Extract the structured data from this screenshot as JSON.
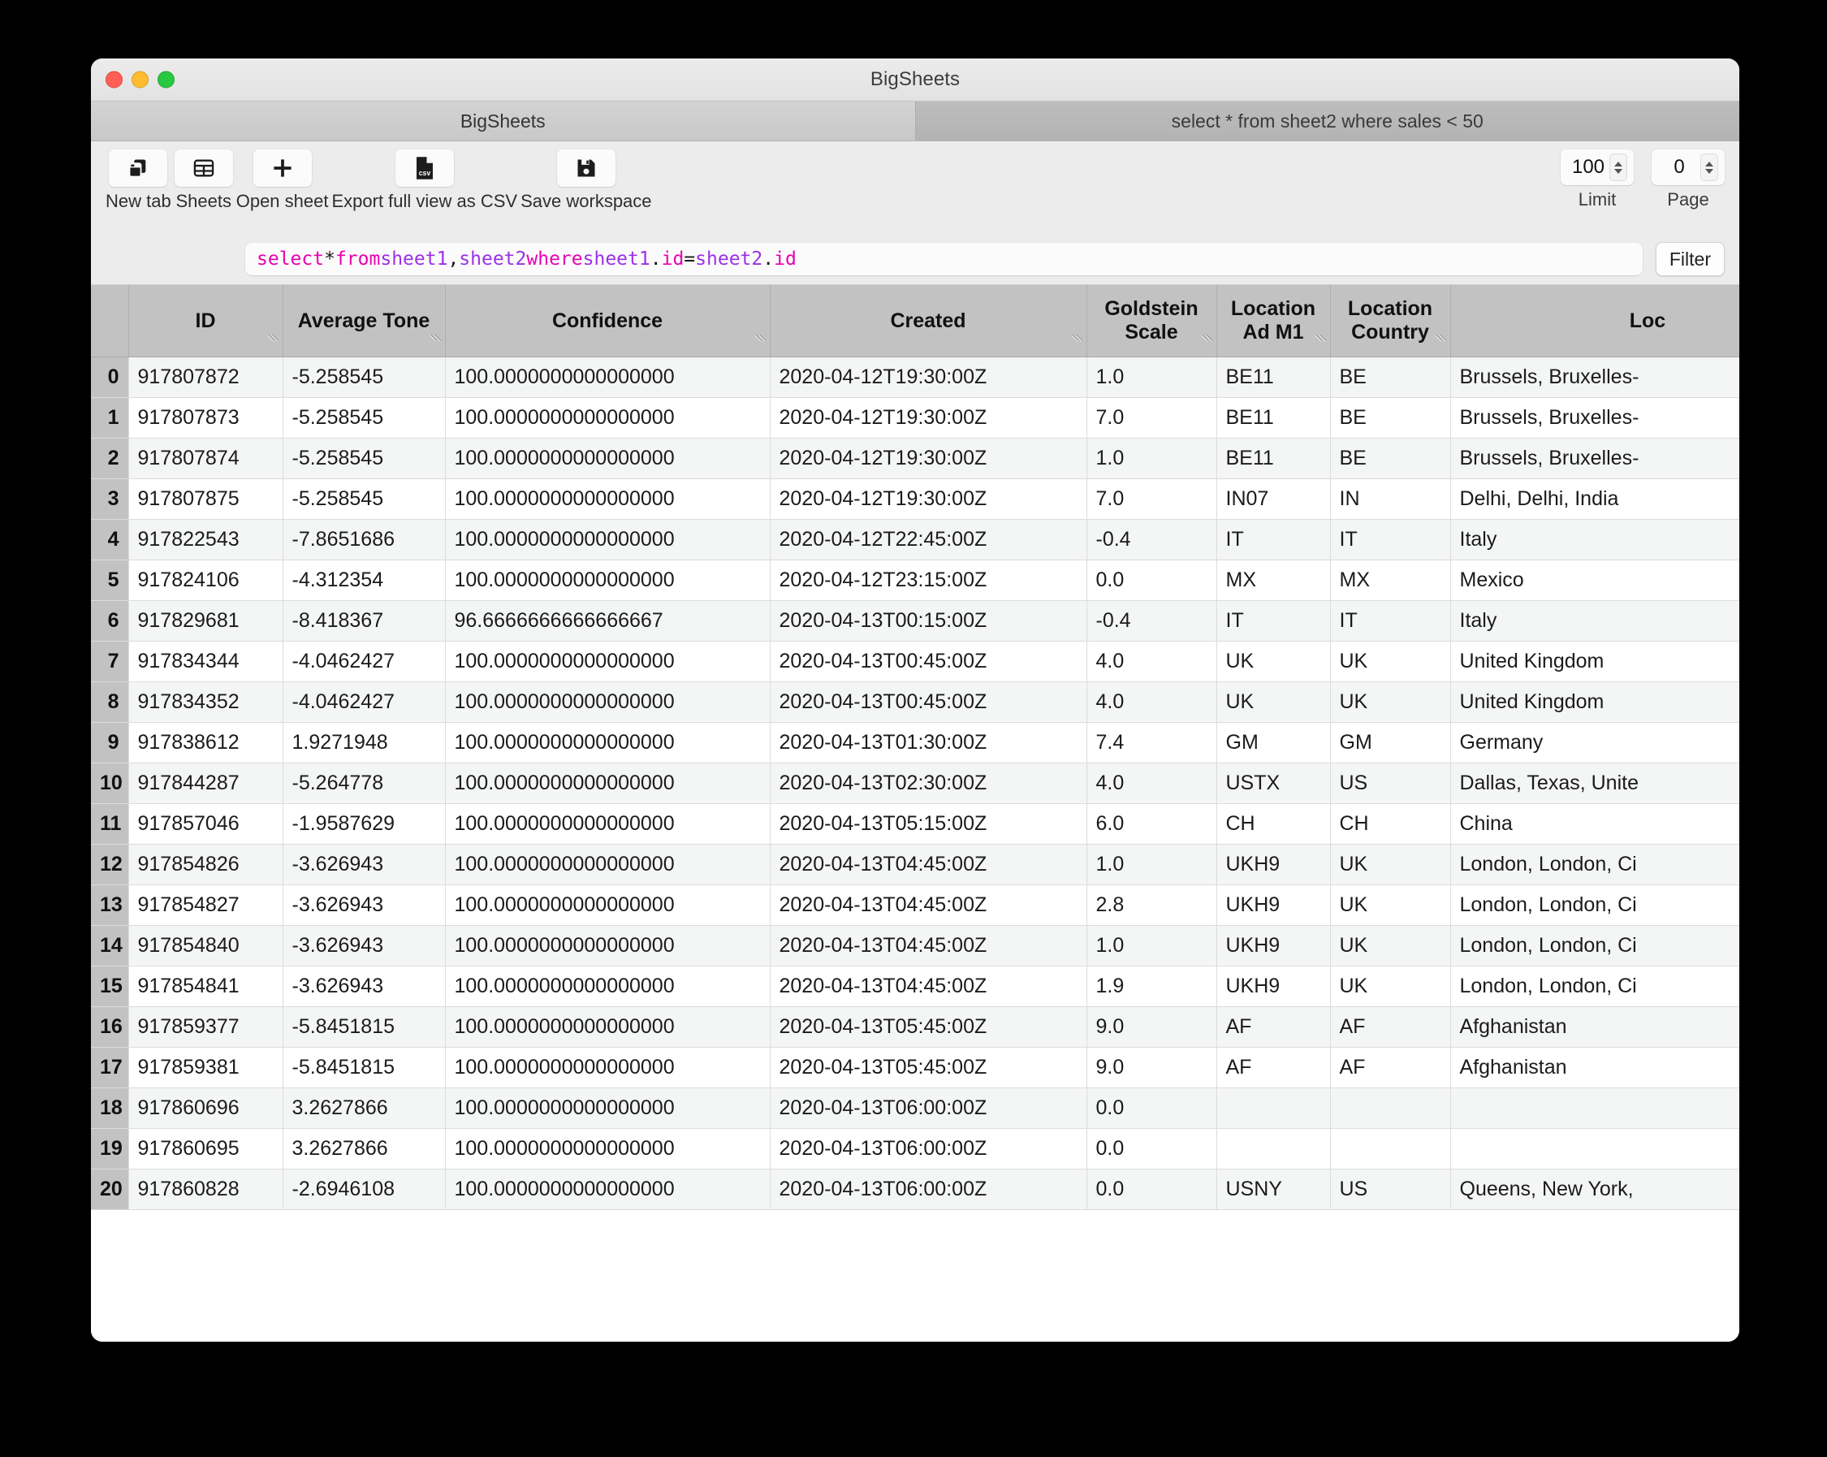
{
  "window": {
    "title": "BigSheets",
    "traffic_lights": [
      "close",
      "minimize",
      "maximize"
    ]
  },
  "tabs": [
    {
      "label": "BigSheets",
      "active": true
    },
    {
      "label": "select * from sheet2 where sales < 50",
      "active": false
    }
  ],
  "toolbar": {
    "buttons": [
      {
        "label": "New tab",
        "icon": "new-tab-icon"
      },
      {
        "label": "Sheets",
        "icon": "sheets-grid-icon"
      },
      {
        "label": "Open sheet",
        "icon": "plus-icon"
      },
      {
        "label": "Export full view as CSV",
        "icon": "csv-file-icon"
      },
      {
        "label": "Save workspace",
        "icon": "floppy-disk-icon"
      }
    ],
    "limit": {
      "label": "Limit",
      "value": "100"
    },
    "page": {
      "label": "Page",
      "value": "0"
    }
  },
  "query": {
    "text": "select * from sheet1, sheet2 where sheet1.id = sheet2.id",
    "tokens": [
      {
        "t": "select",
        "k": "kw"
      },
      {
        "t": " ",
        "k": "plain"
      },
      {
        "t": "*",
        "k": "plain"
      },
      {
        "t": " ",
        "k": "plain"
      },
      {
        "t": "from",
        "k": "kw"
      },
      {
        "t": " ",
        "k": "plain"
      },
      {
        "t": "sheet1",
        "k": "ident"
      },
      {
        "t": ", ",
        "k": "plain"
      },
      {
        "t": "sheet2",
        "k": "ident"
      },
      {
        "t": " ",
        "k": "plain"
      },
      {
        "t": "where",
        "k": "kw"
      },
      {
        "t": " ",
        "k": "plain"
      },
      {
        "t": "sheet1",
        "k": "ident"
      },
      {
        "t": ".",
        "k": "plain"
      },
      {
        "t": "id",
        "k": "kw"
      },
      {
        "t": " = ",
        "k": "plain"
      },
      {
        "t": "sheet2",
        "k": "ident"
      },
      {
        "t": ".",
        "k": "plain"
      },
      {
        "t": "id",
        "k": "kw"
      }
    ],
    "filter_label": "Filter"
  },
  "table": {
    "columns": [
      "ID",
      "Average Tone",
      "Confidence",
      "Created",
      "Goldstein Scale",
      "Location Ad M1",
      "Location Country",
      "Loc"
    ],
    "rows": [
      {
        "n": "0",
        "id": "917807872",
        "tone": "-5.258545",
        "conf": "100.0000000000000000",
        "created": "2020-04-12T19:30:00Z",
        "gold": "1.0",
        "adm1": "BE11",
        "ctry": "BE",
        "loc": "Brussels, Bruxelles-"
      },
      {
        "n": "1",
        "id": "917807873",
        "tone": "-5.258545",
        "conf": "100.0000000000000000",
        "created": "2020-04-12T19:30:00Z",
        "gold": "7.0",
        "adm1": "BE11",
        "ctry": "BE",
        "loc": "Brussels, Bruxelles-"
      },
      {
        "n": "2",
        "id": "917807874",
        "tone": "-5.258545",
        "conf": "100.0000000000000000",
        "created": "2020-04-12T19:30:00Z",
        "gold": "1.0",
        "adm1": "BE11",
        "ctry": "BE",
        "loc": "Brussels, Bruxelles-"
      },
      {
        "n": "3",
        "id": "917807875",
        "tone": "-5.258545",
        "conf": "100.0000000000000000",
        "created": "2020-04-12T19:30:00Z",
        "gold": "7.0",
        "adm1": "IN07",
        "ctry": "IN",
        "loc": "Delhi, Delhi, India"
      },
      {
        "n": "4",
        "id": "917822543",
        "tone": "-7.8651686",
        "conf": "100.0000000000000000",
        "created": "2020-04-12T22:45:00Z",
        "gold": "-0.4",
        "adm1": "IT",
        "ctry": "IT",
        "loc": "Italy"
      },
      {
        "n": "5",
        "id": "917824106",
        "tone": "-4.312354",
        "conf": "100.0000000000000000",
        "created": "2020-04-12T23:15:00Z",
        "gold": "0.0",
        "adm1": "MX",
        "ctry": "MX",
        "loc": "Mexico"
      },
      {
        "n": "6",
        "id": "917829681",
        "tone": "-8.418367",
        "conf": "96.6666666666666667",
        "created": "2020-04-13T00:15:00Z",
        "gold": "-0.4",
        "adm1": "IT",
        "ctry": "IT",
        "loc": "Italy"
      },
      {
        "n": "7",
        "id": "917834344",
        "tone": "-4.0462427",
        "conf": "100.0000000000000000",
        "created": "2020-04-13T00:45:00Z",
        "gold": "4.0",
        "adm1": "UK",
        "ctry": "UK",
        "loc": "United Kingdom"
      },
      {
        "n": "8",
        "id": "917834352",
        "tone": "-4.0462427",
        "conf": "100.0000000000000000",
        "created": "2020-04-13T00:45:00Z",
        "gold": "4.0",
        "adm1": "UK",
        "ctry": "UK",
        "loc": "United Kingdom"
      },
      {
        "n": "9",
        "id": "917838612",
        "tone": "1.9271948",
        "conf": "100.0000000000000000",
        "created": "2020-04-13T01:30:00Z",
        "gold": "7.4",
        "adm1": "GM",
        "ctry": "GM",
        "loc": "Germany"
      },
      {
        "n": "10",
        "id": "917844287",
        "tone": "-5.264778",
        "conf": "100.0000000000000000",
        "created": "2020-04-13T02:30:00Z",
        "gold": "4.0",
        "adm1": "USTX",
        "ctry": "US",
        "loc": "Dallas, Texas, Unite"
      },
      {
        "n": "11",
        "id": "917857046",
        "tone": "-1.9587629",
        "conf": "100.0000000000000000",
        "created": "2020-04-13T05:15:00Z",
        "gold": "6.0",
        "adm1": "CH",
        "ctry": "CH",
        "loc": "China"
      },
      {
        "n": "12",
        "id": "917854826",
        "tone": "-3.626943",
        "conf": "100.0000000000000000",
        "created": "2020-04-13T04:45:00Z",
        "gold": "1.0",
        "adm1": "UKH9",
        "ctry": "UK",
        "loc": "London, London, Ci"
      },
      {
        "n": "13",
        "id": "917854827",
        "tone": "-3.626943",
        "conf": "100.0000000000000000",
        "created": "2020-04-13T04:45:00Z",
        "gold": "2.8",
        "adm1": "UKH9",
        "ctry": "UK",
        "loc": "London, London, Ci"
      },
      {
        "n": "14",
        "id": "917854840",
        "tone": "-3.626943",
        "conf": "100.0000000000000000",
        "created": "2020-04-13T04:45:00Z",
        "gold": "1.0",
        "adm1": "UKH9",
        "ctry": "UK",
        "loc": "London, London, Ci"
      },
      {
        "n": "15",
        "id": "917854841",
        "tone": "-3.626943",
        "conf": "100.0000000000000000",
        "created": "2020-04-13T04:45:00Z",
        "gold": "1.9",
        "adm1": "UKH9",
        "ctry": "UK",
        "loc": "London, London, Ci"
      },
      {
        "n": "16",
        "id": "917859377",
        "tone": "-5.8451815",
        "conf": "100.0000000000000000",
        "created": "2020-04-13T05:45:00Z",
        "gold": "9.0",
        "adm1": "AF",
        "ctry": "AF",
        "loc": "Afghanistan"
      },
      {
        "n": "17",
        "id": "917859381",
        "tone": "-5.8451815",
        "conf": "100.0000000000000000",
        "created": "2020-04-13T05:45:00Z",
        "gold": "9.0",
        "adm1": "AF",
        "ctry": "AF",
        "loc": "Afghanistan"
      },
      {
        "n": "18",
        "id": "917860696",
        "tone": "3.2627866",
        "conf": "100.0000000000000000",
        "created": "2020-04-13T06:00:00Z",
        "gold": "0.0",
        "adm1": "",
        "ctry": "",
        "loc": ""
      },
      {
        "n": "19",
        "id": "917860695",
        "tone": "3.2627866",
        "conf": "100.0000000000000000",
        "created": "2020-04-13T06:00:00Z",
        "gold": "0.0",
        "adm1": "",
        "ctry": "",
        "loc": ""
      },
      {
        "n": "20",
        "id": "917860828",
        "tone": "-2.6946108",
        "conf": "100.0000000000000000",
        "created": "2020-04-13T06:00:00Z",
        "gold": "0.0",
        "adm1": "USNY",
        "ctry": "US",
        "loc": "Queens, New York,"
      }
    ]
  },
  "colors": {
    "keyword": "#e800b0",
    "identifier": "#9b30e8",
    "header_bg": "#c2c2c2",
    "row_even": "#f4f5f5",
    "row_odd": "#ffffff"
  }
}
